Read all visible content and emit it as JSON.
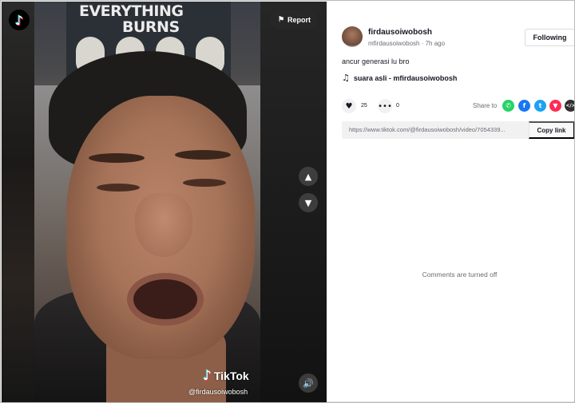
{
  "video": {
    "poster_line1": "EVERYTHING",
    "poster_line2": "BURNS",
    "report_label": "Report",
    "watermark_brand": "TikTok",
    "watermark_user": "@firdausoiwobosh"
  },
  "author": {
    "username": "firdausoiwobosh",
    "handle": "mfirdausoiwobosh",
    "time_ago": "7h ago",
    "follow_label": "Following"
  },
  "post": {
    "caption": "ancur generasi lu bro",
    "music": "suara asli - mfirdausoiwobosh",
    "likes": "25",
    "comments": "0"
  },
  "share": {
    "label": "Share to",
    "link": "https://www.tiktok.com/@firdausoiwobosh/video/7054339...",
    "copy_label": "Copy link"
  },
  "comments_status": "Comments are turned off",
  "colors": {
    "whatsapp": "#25d366",
    "facebook": "#1877f2",
    "twitter": "#1da1f2",
    "pinterest": "#fe2c55"
  }
}
